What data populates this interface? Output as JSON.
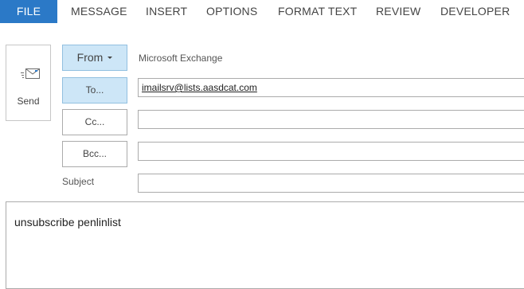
{
  "ribbon": {
    "tabs": [
      {
        "label": "FILE"
      },
      {
        "label": "MESSAGE"
      },
      {
        "label": "INSERT"
      },
      {
        "label": "OPTIONS"
      },
      {
        "label": "FORMAT TEXT"
      },
      {
        "label": "REVIEW"
      },
      {
        "label": "DEVELOPER"
      }
    ],
    "file_tab_color": "#2b79c7"
  },
  "send": {
    "label": "Send",
    "icon": "send-envelope-icon"
  },
  "header": {
    "from_label": "From",
    "from_value": "Microsoft Exchange",
    "to_label": "To...",
    "to_value": "imailsrv@lists.aasdcat.com",
    "cc_label": "Cc...",
    "cc_value": "",
    "bcc_label": "Bcc...",
    "bcc_value": "",
    "subject_label": "Subject",
    "subject_value": ""
  },
  "body": {
    "text": "unsubscribe penlinlist"
  },
  "colors": {
    "active_button_bg": "#cde6f7",
    "border": "#ababab"
  }
}
